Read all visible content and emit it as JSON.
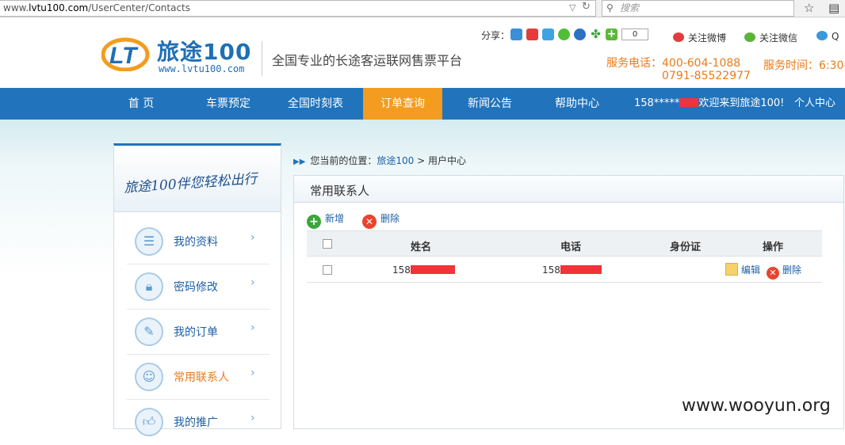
{
  "browser": {
    "url_prefix": "www.",
    "url_domain": "lvtu100.com",
    "url_path": "/UserCenter/Contacts",
    "search_placeholder": "搜索"
  },
  "header": {
    "logo_cn": "旅途100",
    "logo_url": "www.lvtu100.com",
    "slogan": "全国专业的长途客运联网售票平台",
    "share_label": "分享：",
    "share_count": "0",
    "follow_weibo": "关注微博",
    "follow_weixin": "关注微信",
    "follow_qq": "Q",
    "hotline_label": "服务电话：",
    "hotline_1": "400-604-1088",
    "hotline_2": "0791-85522977",
    "service_time": "服务时间：6:30-"
  },
  "nav": {
    "items": [
      "首 页",
      "车票预定",
      "全国时刻表",
      "订单查询",
      "新闻公告",
      "帮助中心"
    ],
    "active_index": 3,
    "welcome_prefix": "158*****",
    "welcome_suffix": "欢迎来到旅途100!",
    "user_center": "个人中心"
  },
  "sidebar": {
    "banner": "旅途100伴您轻松出行",
    "items": [
      {
        "label": "我的资料",
        "icon": "profile-icon"
      },
      {
        "label": "密码修改",
        "icon": "lock-icon"
      },
      {
        "label": "我的订单",
        "icon": "edit-order-icon"
      },
      {
        "label": "常用联系人",
        "icon": "contacts-icon"
      },
      {
        "label": "我的推广",
        "icon": "thumbs-up-icon"
      }
    ],
    "active_index": 3
  },
  "main": {
    "breadcrumb_label": "您当前的位置：",
    "breadcrumb_home": "旅途100",
    "breadcrumb_sep": ">",
    "breadcrumb_current": "用户中心",
    "panel_title": "常用联系人",
    "add_label": "新增",
    "delete_label": "删除",
    "columns": [
      "姓名",
      "电话",
      "身份证",
      "操作"
    ],
    "rows": [
      {
        "name": "158",
        "phone": "158",
        "id_card": "",
        "edit": "编辑",
        "delete": "删除"
      }
    ]
  },
  "watermark": "www.wooyun.org",
  "colors": {
    "nav_bg": "#2173bb",
    "nav_active": "#f39c1f",
    "accent_orange": "#ec7a18",
    "link_blue": "#1d5fa5",
    "redaction": "#f2333a"
  }
}
